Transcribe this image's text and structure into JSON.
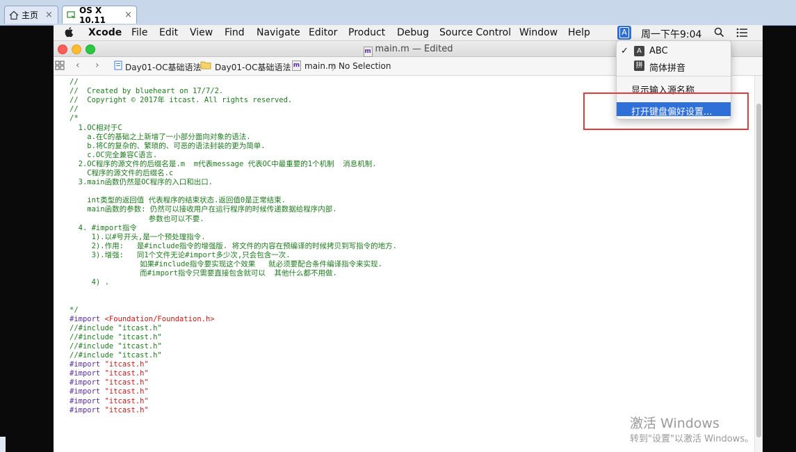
{
  "host": {
    "tabs": [
      {
        "label": "主页",
        "close": "×"
      },
      {
        "label": "OS X 10.11",
        "close": "×"
      }
    ]
  },
  "menubar": {
    "app": "Xcode",
    "items": [
      "File",
      "Edit",
      "View",
      "Find",
      "Navigate",
      "Editor",
      "Product",
      "Debug",
      "Source Control",
      "Window",
      "Help"
    ],
    "input_badge": "A",
    "clock": "周一下午9:04"
  },
  "window": {
    "title": "main.m — Edited"
  },
  "jumpbar": {
    "crumbs": [
      "Day01-OC基础语法",
      "Day01-OC基础语法",
      "main.m",
      "No Selection"
    ]
  },
  "input_menu": {
    "items": [
      {
        "check": "✓",
        "badge": "A",
        "label": "ABC"
      },
      {
        "badge": "拼",
        "label": "简体拼音"
      },
      {
        "label": "显示输入源名称"
      },
      {
        "label": "打开键盘偏好设置..."
      }
    ]
  },
  "code": {
    "lines": [
      {
        "text": "//",
        "kind": "comment"
      },
      {
        "text": "//  Created by blueheart on 17/7/2.",
        "kind": "comment"
      },
      {
        "text": "//  Copyright © 2017年 itcast. All rights reserved.",
        "kind": "comment"
      },
      {
        "text": "//",
        "kind": "comment"
      },
      {
        "text": "/*",
        "kind": "comment"
      },
      {
        "text": "  1.OC相对于C",
        "kind": "comment"
      },
      {
        "text": "    a.在C的基础之上新增了一小部分面向对象的语法.",
        "kind": "comment"
      },
      {
        "text": "    b.将C的复杂的、繁琐的、可恶的语法封装的更为简单.",
        "kind": "comment"
      },
      {
        "text": "    c.OC完全兼容C语言.",
        "kind": "comment"
      },
      {
        "text": "  2.OC程序的源文件的后缀名是.m  m代表message 代表OC中最重要的1个机制  消息机制.",
        "kind": "comment"
      },
      {
        "text": "    C程序的源文件的后缀名.c",
        "kind": "comment"
      },
      {
        "text": "  3.main函数仍然是OC程序的入口和出口.",
        "kind": "comment"
      },
      {
        "text": "",
        "kind": "comment"
      },
      {
        "text": "    int类型的返回值 代表程序的结束状态.返回值0是正常结束.",
        "kind": "comment"
      },
      {
        "text": "    main函数的参数: 仍然可以接收用户在运行程序的时候传递数据给程序内部.",
        "kind": "comment"
      },
      {
        "text": "                  参数也可以不要.",
        "kind": "comment"
      },
      {
        "text": "  4. #import指令",
        "kind": "comment"
      },
      {
        "text": "     1).以#号开头,是一个预处理指令.",
        "kind": "comment"
      },
      {
        "text": "     2).作用:   是#include指令的增强版. 将文件的内容在预编译的时候拷贝到写指令的地方.",
        "kind": "comment"
      },
      {
        "text": "     3).增强:   同1个文件无论#import多少次,只会包含一次.",
        "kind": "comment"
      },
      {
        "text": "                如果#include指令要实现这个效果   就必须要配合条件编译指令来实现.",
        "kind": "comment"
      },
      {
        "text": "                而#import指令只需要直接包含就可以  其他什么都不用做.",
        "kind": "comment"
      },
      {
        "text": "     4) .",
        "kind": "comment"
      },
      {
        "text": "",
        "kind": "comment"
      },
      {
        "text": "",
        "kind": "comment"
      },
      {
        "text": "*/",
        "kind": "comment"
      },
      {
        "text": "#import <Foundation/Foundation.h>",
        "kind": "import_sys"
      },
      {
        "text": "//#include \"itcast.h\"",
        "kind": "comment"
      },
      {
        "text": "//#include \"itcast.h\"",
        "kind": "comment"
      },
      {
        "text": "//#include \"itcast.h\"",
        "kind": "comment"
      },
      {
        "text": "//#include \"itcast.h\"",
        "kind": "comment"
      },
      {
        "text": "#import \"itcast.h\"",
        "kind": "import"
      },
      {
        "text": "#import \"itcast.h\"",
        "kind": "import"
      },
      {
        "text": "#import \"itcast.h\"",
        "kind": "import"
      },
      {
        "text": "#import \"itcast.h\"",
        "kind": "import"
      },
      {
        "text": "#import \"itcast.h\"",
        "kind": "import"
      },
      {
        "text": "#import \"itcast.h\"",
        "kind": "import"
      }
    ]
  },
  "watermark": {
    "line1": "激活 Windows",
    "line2": "转到\"设置\"以激活 Windows。"
  },
  "colors": {
    "comment": "#1e7a1e",
    "preprocessor": "#5a2aa0",
    "string": "#c41a16",
    "selection": "#2f6fd8",
    "annotation_box": "#e23b3b"
  }
}
